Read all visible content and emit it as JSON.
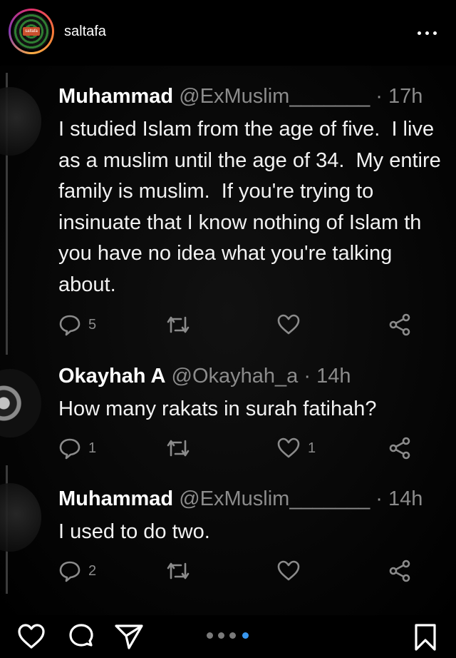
{
  "header": {
    "username": "saltafa",
    "avatar_label": "saltafa"
  },
  "tweets": [
    {
      "name": "Muhammad",
      "handle": "@ExMuslim_______",
      "separator": "·",
      "time": "17h",
      "text": "I studied Islam from the age of five.  I live\nas a muslim until the age of 34.  My entire\nfamily is muslim.  If you're trying to\ninsinuate that I know nothing of Islam th\nyou have no idea what you're talking\nabout.",
      "replies": "5",
      "likes": ""
    },
    {
      "name": "Okayhah A",
      "handle": "@Okayhah_a",
      "separator": "·",
      "time": "14h",
      "text": "How many rakats in surah fatihah?",
      "replies": "1",
      "likes": "1"
    },
    {
      "name": "Muhammad",
      "handle": "@ExMuslim_______",
      "separator": "·",
      "time": "14h",
      "text": "I used to do two.",
      "replies": "2",
      "likes": ""
    }
  ],
  "icons": {
    "reply": "comment-bubble-icon",
    "retweet": "retweet-icon",
    "like": "heart-icon",
    "share": "share-icon"
  },
  "footer": {
    "carousel_total": 4,
    "carousel_active": 4
  },
  "colors": {
    "background": "#000000",
    "muted": "#8b8b8b",
    "carousel_active": "#3897f0"
  }
}
